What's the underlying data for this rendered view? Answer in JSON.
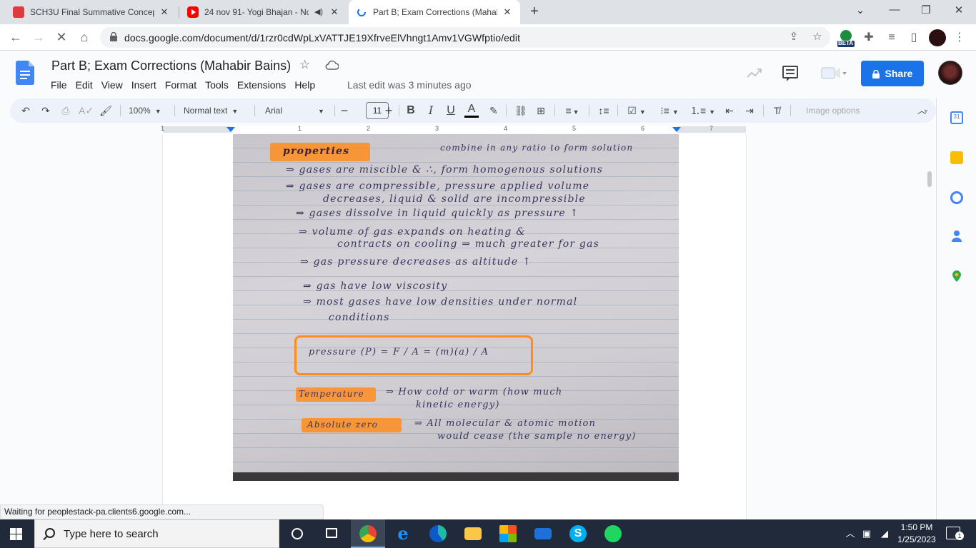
{
  "browser": {
    "tabs": [
      {
        "title": "SCH3U Final Summative Concept",
        "active": false
      },
      {
        "title": "24 nov 91- Yogi Bhajan - No",
        "active": false
      },
      {
        "title": "Part B; Exam Corrections (Mahab",
        "active": true
      }
    ],
    "url": "docs.google.com/document/d/1rzr0cdWpLxVATTJE19XfrveElVhngt1Amv1VGWfptio/edit",
    "beta_badge": "BETA"
  },
  "doc": {
    "title": "Part B; Exam Corrections (Mahabir Bains)",
    "menu": [
      "File",
      "Edit",
      "View",
      "Insert",
      "Format",
      "Tools",
      "Extensions",
      "Help"
    ],
    "last_edit": "Last edit was 3 minutes ago",
    "share_label": "Share"
  },
  "toolbar": {
    "zoom": "100%",
    "style": "Normal text",
    "font": "Arial",
    "font_size": "11",
    "image_options": "Image options"
  },
  "ruler": {
    "numbers": [
      "1",
      "1",
      "2",
      "3",
      "4",
      "5",
      "6",
      "7"
    ]
  },
  "handwriting": {
    "heading": "properties",
    "lines": [
      "combine in any ratio to form solution",
      "⇒ gases are miscible & ∴, form homogenous solutions",
      "⇒ gases are compressible, pressure applied volume",
      "decreases, liquid & solid are incompressible",
      "⇒ gases dissolve in liquid quickly as pressure ↑",
      "⇒ volume of gas expands on heating &",
      "contracts on cooling ⇒ much greater for gas",
      "⇒ gas pressure decreases as altitude ↑",
      "⇒ gas have low viscosity",
      "⇒ most gases have low densities under normal",
      "conditions"
    ],
    "pressure_formula": "pressure (P) = F / A = (m)(a) / A",
    "temperature_label": "Temperature",
    "temperature_text": "⇒ How cold or warm (how much",
    "temperature_text2": "kinetic energy)",
    "absolute_label": "Absolute zero",
    "absolute_text": "⇒ All molecular & atomic motion",
    "absolute_text2": "would cease (the sample no energy)"
  },
  "status": "Waiting for peoplestack-pa.clients6.google.com...",
  "taskbar": {
    "search_placeholder": "Type here to search",
    "time": "1:50 PM",
    "date": "1/25/2023",
    "notification_count": "1"
  },
  "colors": {
    "share_blue": "#1a73e8",
    "highlight_orange": "#ff8c1e",
    "taskbar_bg": "#202a3a"
  }
}
